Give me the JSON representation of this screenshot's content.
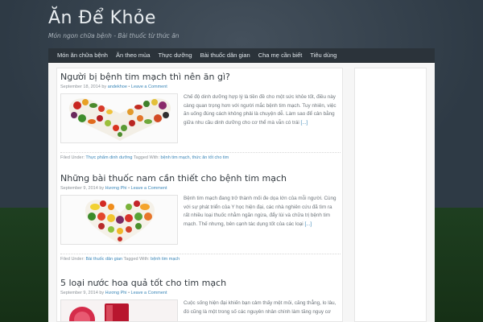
{
  "site": {
    "title": "Ăn Để Khỏe",
    "description": "Món ngon chữa bệnh - Bài thuốc từ thức ăn"
  },
  "nav": {
    "items": [
      {
        "label": "Món ăn chữa bệnh"
      },
      {
        "label": "Ăn theo mùa"
      },
      {
        "label": "Thực dưỡng"
      },
      {
        "label": "Bài thuốc dân gian"
      },
      {
        "label": "Cha mẹ cần biết"
      },
      {
        "label": "Tiêu dùng"
      }
    ]
  },
  "posts": [
    {
      "title": "Người bị bệnh tim mạch thì nên ăn gì?",
      "date": "September 18, 2014",
      "by": "by",
      "author": "andekhoe",
      "bullet": "•",
      "comment": "Leave a Comment",
      "thumb_icon": "vegetables-image",
      "excerpt": "Chế độ dinh dưỡng hợp lý là tiền đề cho một sức khỏe tốt, điều này càng quan trọng hơn với người mắc bệnh tim mạch. Tuy nhiên, việc ăn uống đúng cách không phải là chuyện dễ. Làm sao để cân bằng giữa nhu cầu dinh dưỡng cho cơ thể mà vẫn có trái",
      "more": "[...]",
      "filed_label": "Filed Under:",
      "category": "Thực phẩm dinh dưỡng",
      "tagged_label": "Tagged With:",
      "tags": "bệnh tim mạch, thức ăn tốt cho tim"
    },
    {
      "title": "Những bài thuốc nam cần thiết cho bệnh tim mạch",
      "date": "September 9, 2014",
      "by": "by",
      "author": "Hương Phi",
      "bullet": "•",
      "comment": "Leave a Comment",
      "thumb_icon": "fruit-heart-image",
      "excerpt": "Bệnh tim mạch đang trở thành mối đe dọa lớn của mỗi người. Cùng với sự phát triển của Y học hiện đại, các nhà nghiên cứu đã tìm ra rất nhiều loại thuốc nhằm ngăn ngừa, đẩy lùi và chữa trị bệnh tim mạch. Thế nhưng, bên cạnh tác dụng tốt của các loại",
      "more": "[...]",
      "filed_label": "Filed Under:",
      "category": "Bài thuốc dân gian",
      "tagged_label": "Tagged With:",
      "tags": "bệnh tim mạch"
    },
    {
      "title": "5 loại nước hoa quả tốt cho tim mạch",
      "date": "September 9, 2014",
      "by": "by",
      "author": "Hương Phi",
      "bullet": "•",
      "comment": "Leave a Comment",
      "thumb_icon": "fruit-juice-image",
      "excerpt": "Cuộc sống hiện đại khiến bạn cảm thấy mệt mỏi, căng thẳng, lo lâu, đó cũng là một trong số các nguyên nhân chính làm tăng nguy cơ",
      "more": "",
      "filed_label": "",
      "category": "",
      "tagged_label": "",
      "tags": ""
    }
  ],
  "colors": {
    "link": "#3a86b8",
    "title": "#333a40",
    "nav_bg": "#2b333a"
  }
}
